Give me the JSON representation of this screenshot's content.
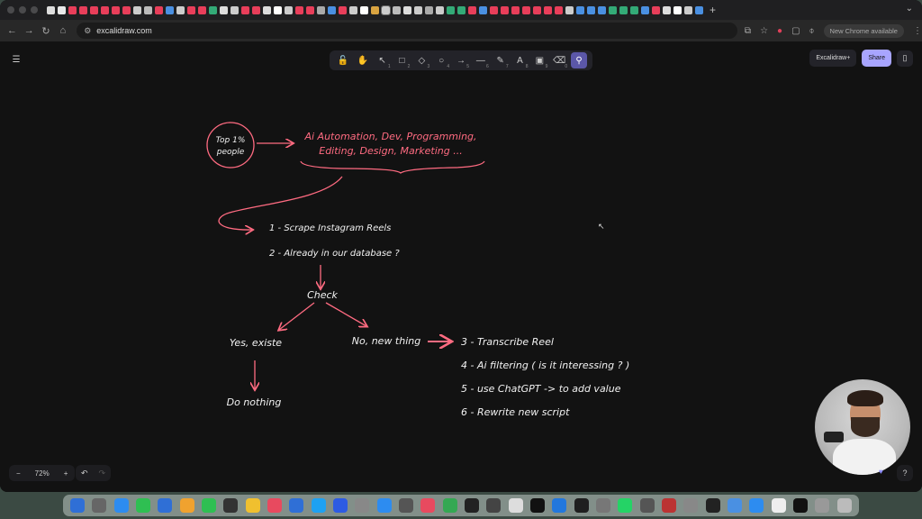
{
  "browser": {
    "url": "excalidraw.com",
    "update_label": "New Chrome available",
    "tab_count_shown": 84
  },
  "toolbar": {
    "tools": [
      {
        "name": "lock",
        "glyph": "🔓",
        "key": ""
      },
      {
        "name": "hand",
        "glyph": "✋",
        "key": ""
      },
      {
        "name": "selection",
        "glyph": "↖",
        "key": "1"
      },
      {
        "name": "rectangle",
        "glyph": "□",
        "key": "2"
      },
      {
        "name": "diamond",
        "glyph": "◇",
        "key": "3"
      },
      {
        "name": "ellipse",
        "glyph": "○",
        "key": "4"
      },
      {
        "name": "arrow",
        "glyph": "→",
        "key": "5"
      },
      {
        "name": "line",
        "glyph": "—",
        "key": "6"
      },
      {
        "name": "pencil",
        "glyph": "✎",
        "key": "7"
      },
      {
        "name": "text",
        "glyph": "A",
        "key": "8"
      },
      {
        "name": "image",
        "glyph": "▣",
        "key": "9"
      },
      {
        "name": "eraser",
        "glyph": "⌫",
        "key": "0"
      },
      {
        "name": "laser",
        "glyph": "⚲",
        "key": ""
      }
    ]
  },
  "header_right": {
    "plus_label": "Excalidraw+",
    "share_label": "Share"
  },
  "footer": {
    "zoom_label": "72%",
    "zoom_out": "−",
    "zoom_in": "+",
    "undo": "↶",
    "redo": "↷",
    "help": "?"
  },
  "diagram": {
    "circle_line1": "Top 1%",
    "circle_line2": "people",
    "topics_line1": "Ai Automation, Dev, Programming,",
    "topics_line2": "Editing, Design, Marketing ...",
    "step1": "1 - Scrape Instagram Reels",
    "step2": "2 - Already in our database ?",
    "check": "Check",
    "yes": "Yes, existe",
    "no": "No, new thing",
    "do_nothing": "Do nothing",
    "step3": "3 - Transcribe Reel",
    "step4": "4 - Ai filtering ( is it interessing ? )",
    "step5": "5 - use ChatGPT -> to add value",
    "step6": "6 - Rewrite new script"
  },
  "colors": {
    "accent_red": "#ff6b81",
    "share_purple": "#a8a5ff",
    "active_tool": "#5b57a8"
  }
}
